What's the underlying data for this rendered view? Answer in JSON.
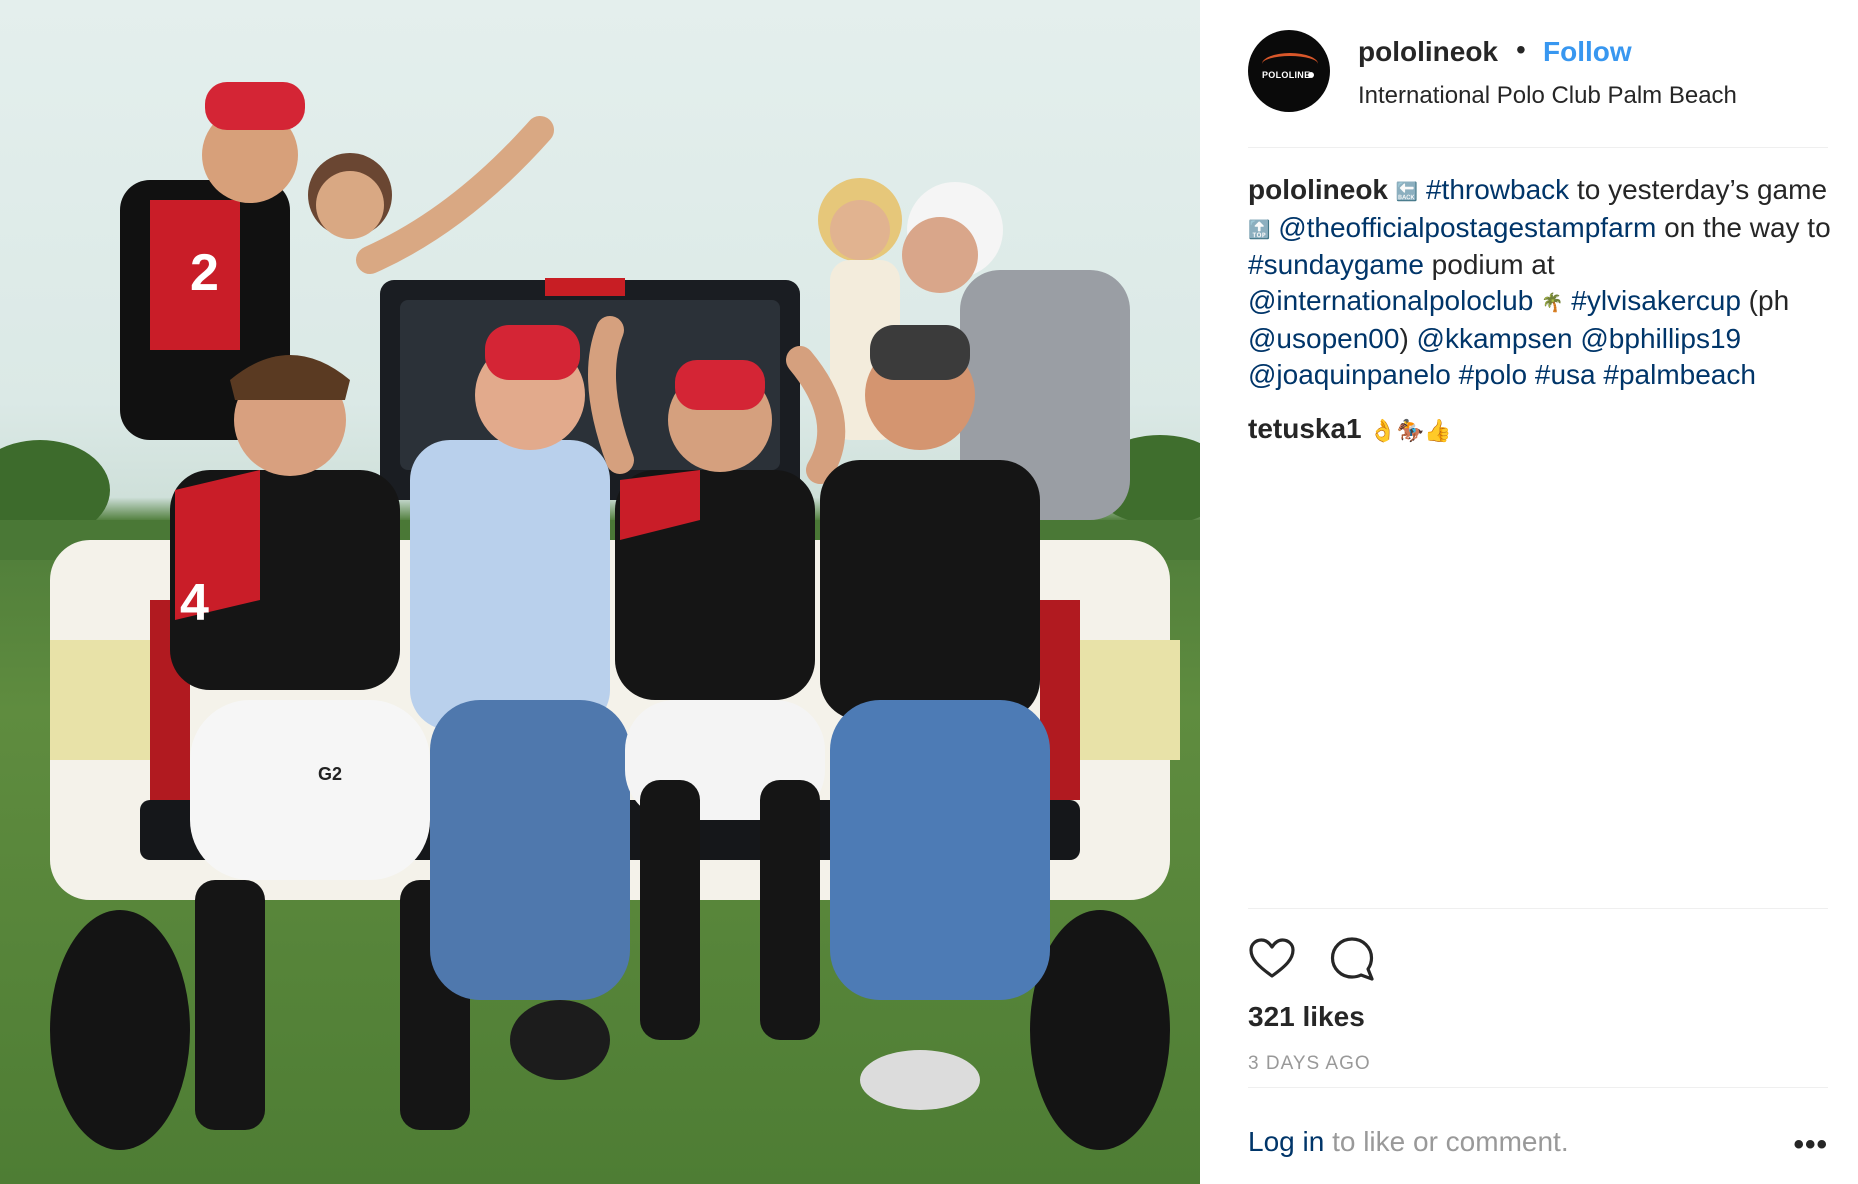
{
  "post": {
    "username": "pololineok",
    "bullet": "•",
    "follow_label": "Follow",
    "location": "International Polo Club Palm Beach",
    "avatar_logo_text": "POLOLINE"
  },
  "caption": {
    "user": "pololineok",
    "emoji_back": "🔙",
    "t1": "#throwback",
    "t2": " to yesterday’s game ",
    "emoji_top": "🔝",
    "t3": "@theofficialpostagestampfarm",
    "t4": " on the way to ",
    "t5": "#sundaygame",
    "t6": " podium at ",
    "t7": "@internationalpoloclub",
    "emoji_palm": "🌴",
    "t8": "#ylvisakercup",
    "t9": " (ph ",
    "t10": "@usopen00",
    "t11": ") ",
    "t12": "@kkampsen",
    "t13": "@bphillips19",
    "t14": "@joaquinpanelo",
    "t15": "#polo",
    "t16": "#usa",
    "t17": "#palmbeach"
  },
  "comment2": {
    "user": "tetuska1",
    "emoji": "👌🏇👍"
  },
  "actions": {
    "heart_icon": "heart-icon",
    "comment_icon": "comment-icon",
    "likes": "321 likes",
    "time_ago": "3 DAYS AGO"
  },
  "footer": {
    "login": "Log in",
    "rest": " to like or comment.",
    "more": "•••"
  },
  "photo": {
    "jersey_numbers": [
      "2",
      "4"
    ],
    "bottle_label": "G2"
  },
  "colors": {
    "link": "#003569",
    "follow": "#3897f0",
    "muted": "#999999",
    "divider": "#efefef"
  }
}
